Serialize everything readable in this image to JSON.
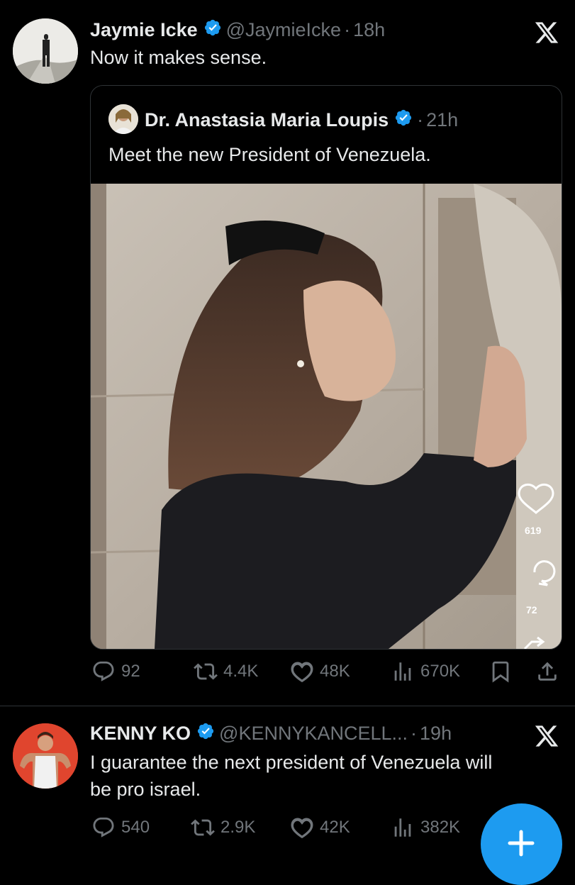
{
  "tweet1": {
    "name": "Jaymie Icke",
    "handle": "@JaymieIcke",
    "time": "18h",
    "text": "Now it makes sense.",
    "quote": {
      "name": "Dr. Anastasia Maria Loupis",
      "time": "21h",
      "text": "Meet the new President of Venezuela.",
      "video_likes": "619",
      "video_comments": "72"
    },
    "actions": {
      "replies": "92",
      "reposts": "4.4K",
      "likes": "48K",
      "views": "670K"
    }
  },
  "tweet2": {
    "name": "KENNY KO",
    "handle": "@KENNYKANCELL...",
    "time": "19h",
    "text_line1": "I guarantee the next president of Venezuela will",
    "text_line2": "be pro israel.",
    "actions": {
      "replies": "540",
      "reposts": "2.9K",
      "likes": "42K",
      "views": "382K"
    }
  },
  "dot": "·",
  "colors": {
    "accent": "#1d9bf0",
    "muted": "#71767b",
    "text": "#e7e9ea",
    "border": "#2f3336"
  },
  "icons": [
    "verified-badge-icon",
    "x-logo-icon",
    "reply-icon",
    "repost-icon",
    "like-icon",
    "views-icon",
    "bookmark-icon",
    "share-icon",
    "compose-plus-icon"
  ]
}
